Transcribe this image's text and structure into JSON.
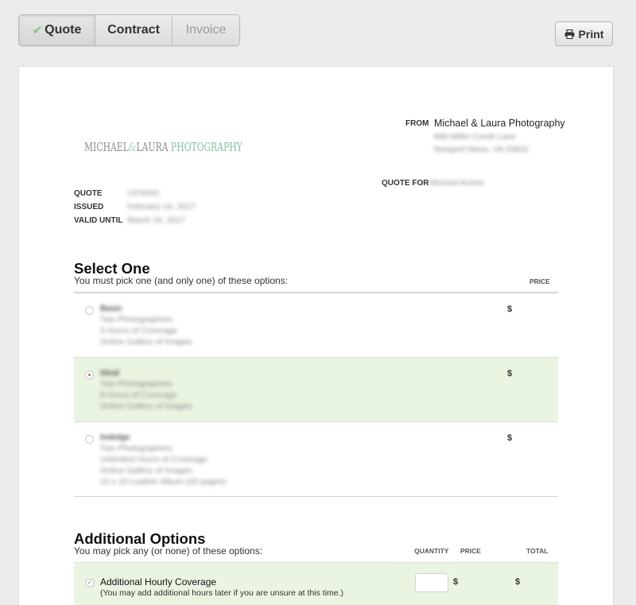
{
  "tabs": [
    {
      "label": "Quote",
      "completed": true
    },
    {
      "label": "Contract"
    },
    {
      "label": "Invoice",
      "disabled": true
    }
  ],
  "print_label": "Print",
  "logo": {
    "part1": "MICHAEL",
    "amp": "&",
    "part2": "LAURA",
    "part3": "PHOTOGRAPHY"
  },
  "header": {
    "from_label": "FROM",
    "from_name": "Michael & Laura Photography",
    "from_address_line1": "868 Miller Creek Lane",
    "from_address_line2": "Newport News, VA 23602",
    "quote_for_label": "QUOTE FOR",
    "quote_for_value": "Michael Archer"
  },
  "meta": [
    {
      "label": "QUOTE",
      "value": "1376041"
    },
    {
      "label": "ISSUED",
      "value": "February 16, 2017"
    },
    {
      "label": "VALID UNTIL",
      "value": "March 19, 2017"
    }
  ],
  "select_one": {
    "title": "Select One",
    "subtitle": "You must pick one (and only one) of these options:",
    "price_header": "PRICE",
    "options": [
      {
        "name": "Basic",
        "details": [
          "Two Photographers",
          "5 Hours of Coverage",
          "Online Gallery of Images"
        ],
        "currency": "$",
        "selected": false
      },
      {
        "name": "Ideal",
        "details": [
          "Two Photographers",
          "8 Hours of Coverage",
          "Online Gallery of Images"
        ],
        "currency": "$",
        "selected": true
      },
      {
        "name": "Indulge",
        "details": [
          "Two Photographers",
          "Unlimited Hours of Coverage",
          "Online Gallery of Images",
          "10 x 10 Leather Album (20 pages)"
        ],
        "currency": "$",
        "selected": false
      }
    ]
  },
  "additional": {
    "title": "Additional Options",
    "subtitle": "You may pick any (or none) of these options:",
    "quantity_header": "QUANTITY",
    "price_header": "PRICE",
    "total_header": "TOTAL",
    "items": [
      {
        "title": "Additional Hourly Coverage",
        "note": "(You may add additional hours later if you are unsure at this time.)",
        "checked": true,
        "price_currency": "$",
        "total_currency": "$"
      }
    ]
  }
}
